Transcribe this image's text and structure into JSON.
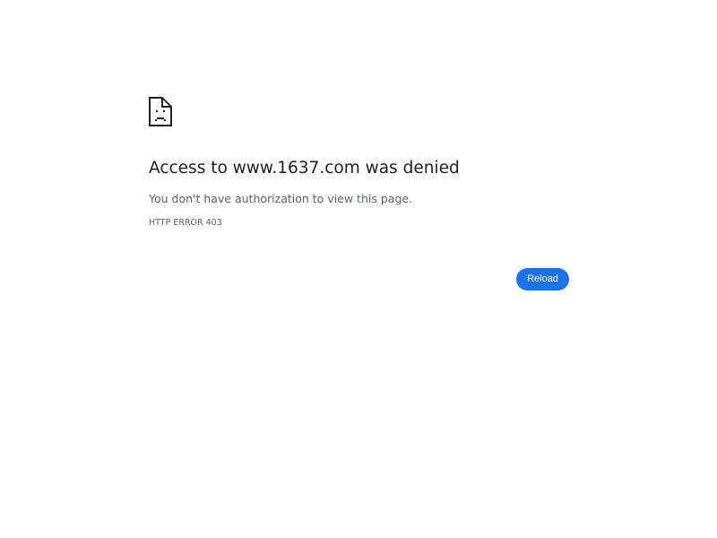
{
  "error": {
    "icon": "sad-page-icon",
    "heading": "Access to www.1637.com was denied",
    "message": "You don't have authorization to view this page.",
    "code": "HTTP ERROR 403"
  },
  "actions": {
    "reload_label": "Reload"
  },
  "colors": {
    "heading": "#202124",
    "secondary_text": "#5f6368",
    "button_background": "#1a73e8",
    "button_text": "#ffffff",
    "icon_stroke": "#202124"
  }
}
